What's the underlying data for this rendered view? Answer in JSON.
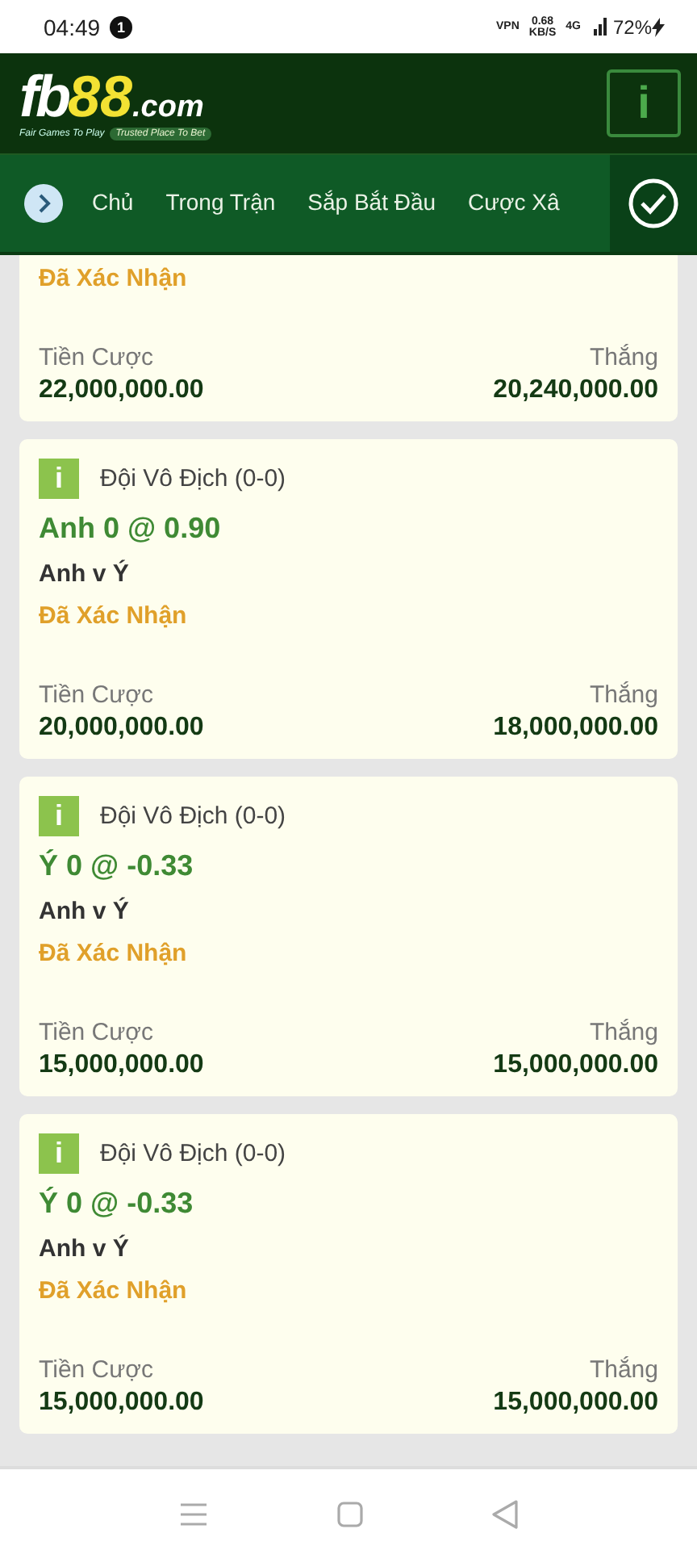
{
  "status_bar": {
    "time": "04:49",
    "notification_count": "1",
    "vpn": "VPN",
    "speed": "0.68",
    "speed_unit": "KB/S",
    "network": "4G",
    "battery": "72%"
  },
  "header": {
    "logo": {
      "part_1": "fb",
      "part_2": "88",
      "part_3": ".com",
      "tagline_1": "Fair Games To Play",
      "tagline_2": "Trusted Place To Bet"
    },
    "info_button": "i"
  },
  "nav": {
    "tabs": [
      {
        "label": "Chủ",
        "selected": false
      },
      {
        "label": "Trong Trận",
        "selected": false
      },
      {
        "label": "Sắp Bắt Đầu",
        "selected": false
      },
      {
        "label": "Cược Xâ",
        "selected": false
      }
    ]
  },
  "bets": [
    {
      "status": "Đã Xác Nhận",
      "stake_label": "Tiền Cược",
      "stake": "22,000,000.00",
      "win_label": "Thắng",
      "win": "20,240,000.00"
    },
    {
      "info": "i",
      "market": "Đội Vô Địch (0-0)",
      "selection": "Anh 0 @ 0.90",
      "match": "Anh v Ý",
      "status": "Đã Xác Nhận",
      "stake_label": "Tiền Cược",
      "stake": "20,000,000.00",
      "win_label": "Thắng",
      "win": "18,000,000.00"
    },
    {
      "info": "i",
      "market": "Đội Vô Địch (0-0)",
      "selection": "Ý 0 @ -0.33",
      "match": "Anh v Ý",
      "status": "Đã Xác Nhận",
      "stake_label": "Tiền Cược",
      "stake": "15,000,000.00",
      "win_label": "Thắng",
      "win": "15,000,000.00"
    },
    {
      "info": "i",
      "market": "Đội Vô Địch (0-0)",
      "selection": "Ý 0 @ -0.33",
      "match": "Anh v Ý",
      "status": "Đã Xác Nhận",
      "stake_label": "Tiền Cược",
      "stake": "15,000,000.00",
      "win_label": "Thắng",
      "win": "15,000,000.00"
    }
  ]
}
